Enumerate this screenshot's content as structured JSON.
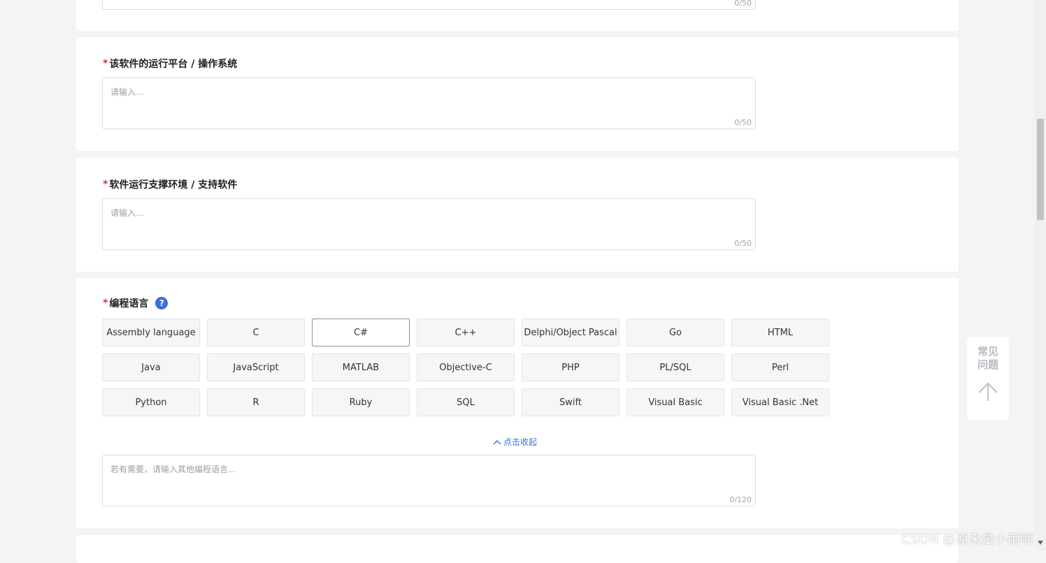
{
  "card0": {
    "count": "0/50"
  },
  "platform": {
    "required_mark": "*",
    "label": "该软件的运行平台 / 操作系统",
    "placeholder": "请输入...",
    "count": "0/50"
  },
  "environment": {
    "required_mark": "*",
    "label": "软件运行支撑环境 / 支持软件",
    "placeholder": "请输入...",
    "count": "0/50"
  },
  "language": {
    "required_mark": "*",
    "label": "编程语言",
    "help_glyph": "?",
    "options": [
      "Assembly language",
      "C",
      "C#",
      "C++",
      "Delphi/Object Pascal",
      "Go",
      "HTML",
      "Java",
      "JavaScript",
      "MATLAB",
      "Objective-C",
      "PHP",
      "PL/SQL",
      "Perl",
      "Python",
      "R",
      "Ruby",
      "SQL",
      "Swift",
      "Visual Basic",
      "Visual Basic .Net"
    ],
    "selected": "C#",
    "collapse_label": "点击收起",
    "other_placeholder": "若有需要，请输入其他编程语言...",
    "other_count": "0/120"
  },
  "faq": {
    "label": "常见问题"
  },
  "watermark": "CSDN @原来是小雨啊",
  "colors": {
    "accent": "#3c6fd8",
    "required": "#e03030"
  }
}
